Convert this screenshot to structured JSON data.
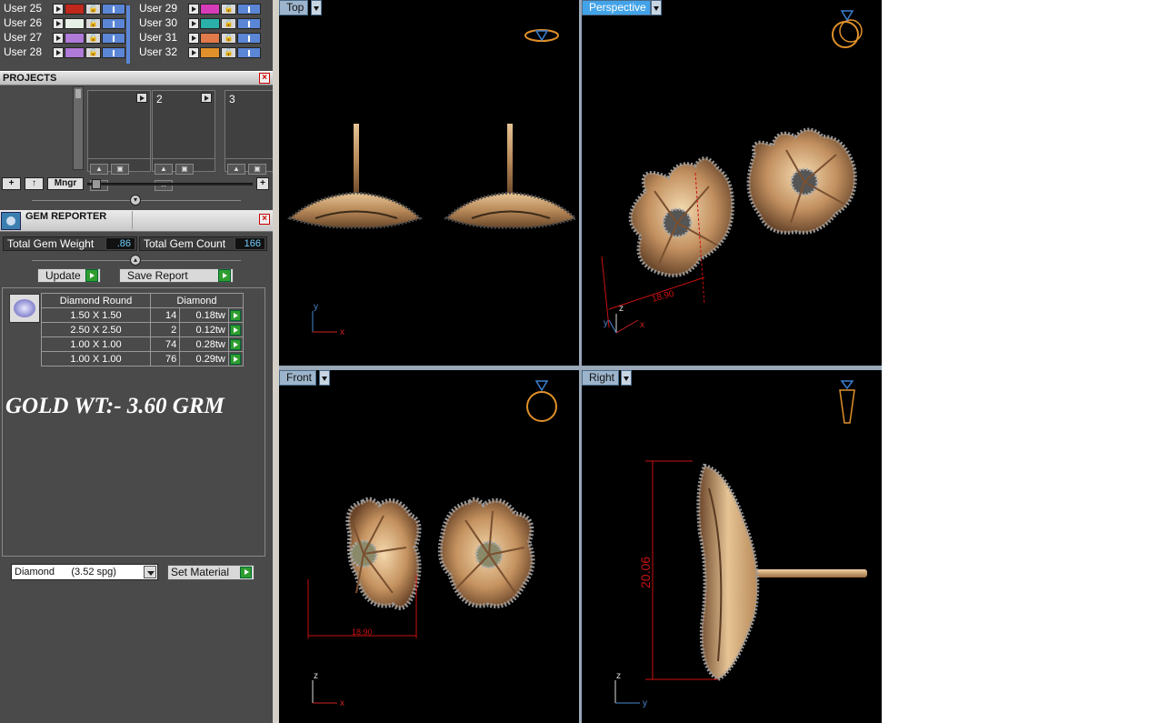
{
  "layers": {
    "left": [
      {
        "name": "User 25",
        "color": "#c0281c"
      },
      {
        "name": "User 26",
        "color": "#e6f0e6"
      },
      {
        "name": "User 27",
        "color": "#b07ad8"
      },
      {
        "name": "User 28",
        "color": "#b07ad8"
      }
    ],
    "right": [
      {
        "name": "User 29",
        "color": "#d63cb8"
      },
      {
        "name": "User 30",
        "color": "#2ab0a8"
      },
      {
        "name": "User 31",
        "color": "#e07a4a"
      },
      {
        "name": "User 32",
        "color": "#e0902a"
      }
    ]
  },
  "projects": {
    "title": "PROJECTS",
    "cards": [
      {
        "num": ""
      },
      {
        "num": "2"
      },
      {
        "num": "3"
      }
    ],
    "manager_label": "Mngr"
  },
  "gem_reporter": {
    "title": "GEM REPORTER",
    "total_weight_label": "Total Gem Weight",
    "total_weight_value": ".86",
    "total_count_label": "Total Gem Count",
    "total_count_value": "166",
    "update_label": "Update",
    "save_label": "Save Report",
    "table": {
      "header_shape": "Diamond Round",
      "header_material": "Diamond",
      "rows": [
        {
          "size": "1.50 X 1.50",
          "count": "14",
          "weight": "0.18tw"
        },
        {
          "size": "2.50 X 2.50",
          "count": "2",
          "weight": "0.12tw"
        },
        {
          "size": "1.00 X 1.00",
          "count": "74",
          "weight": "0.28tw"
        },
        {
          "size": "1.00 X 1.00",
          "count": "76",
          "weight": "0.29tw"
        }
      ]
    },
    "note": "GOLD WT:- 3.60 GRM",
    "material_select": "Diamond      (3.52 spg)",
    "set_material_label": "Set Material"
  },
  "viewports": {
    "top": "Top",
    "perspective": "Perspective",
    "front": "Front",
    "right": "Right"
  },
  "dimensions": {
    "width_front": "18.90",
    "width_perspective": "18.90",
    "height_right": "20.06"
  },
  "axes": {
    "x": "x",
    "y": "y",
    "z": "z"
  },
  "colors": {
    "gold": "#c9a070",
    "gem": "#8a8a8a",
    "dimension": "#cc1111",
    "active_viewport": "#43a3e8"
  }
}
